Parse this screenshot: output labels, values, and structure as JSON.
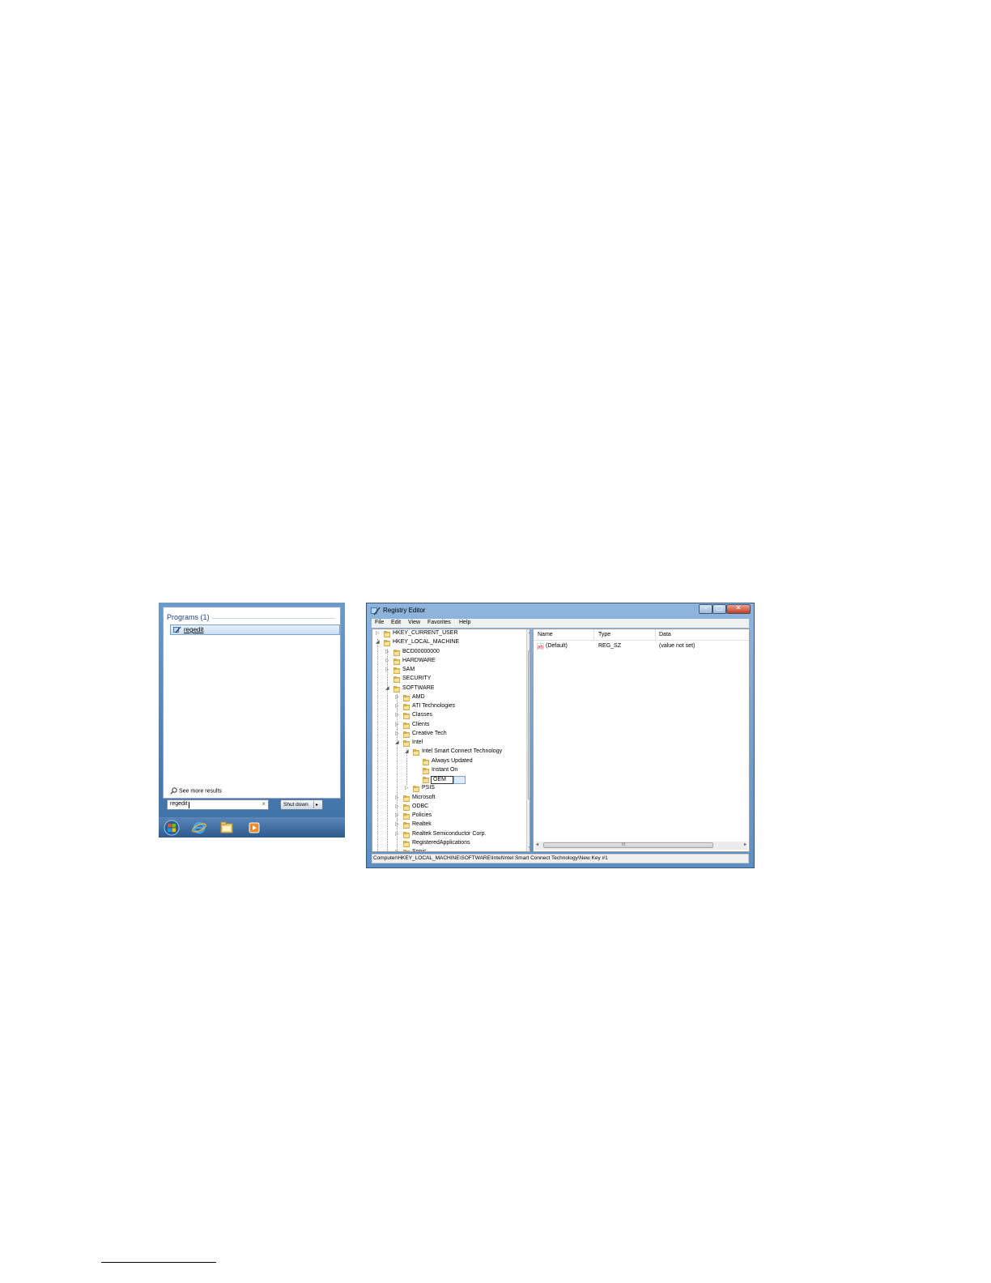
{
  "start_menu": {
    "programs_header": "Programs (1)",
    "result_label": "regedit",
    "see_more": "See more results",
    "search_value": "regedit",
    "clear_symbol": "×",
    "shutdown_label": "Shut down",
    "shutdown_arrow": "▸",
    "taskbar_icons": [
      "start-orb-icon",
      "internet-explorer-icon",
      "file-explorer-icon",
      "media-player-icon"
    ]
  },
  "registry_editor": {
    "title": "Registry Editor",
    "controls": {
      "minimize": "–",
      "maximize": "□",
      "close": "✕"
    },
    "menu": [
      "File",
      "Edit",
      "View",
      "Favorites",
      "Help"
    ],
    "tree": [
      {
        "label": "HKEY_CURRENT_USER",
        "level": 1,
        "expander": "▷"
      },
      {
        "label": "HKEY_LOCAL_MACHINE",
        "level": 1,
        "expander": "◢"
      },
      {
        "label": "BCD00000000",
        "level": 2,
        "expander": "▷"
      },
      {
        "label": "HARDWARE",
        "level": 2,
        "expander": "▷"
      },
      {
        "label": "SAM",
        "level": 2,
        "expander": "▷"
      },
      {
        "label": "SECURITY",
        "level": 2,
        "expander": ""
      },
      {
        "label": "SOFTWARE",
        "level": 2,
        "expander": "◢"
      },
      {
        "label": "AMD",
        "level": 3,
        "expander": "▷"
      },
      {
        "label": "ATI Technologies",
        "level": 3,
        "expander": "▷"
      },
      {
        "label": "Classes",
        "level": 3,
        "expander": "▷"
      },
      {
        "label": "Clients",
        "level": 3,
        "expander": "▷"
      },
      {
        "label": "Creative Tech",
        "level": 3,
        "expander": "▷"
      },
      {
        "label": "Intel",
        "level": 3,
        "expander": "◢"
      },
      {
        "label": "Intel Smart Connect Technology",
        "level": 4,
        "expander": "◢"
      },
      {
        "label": "Always Updated",
        "level": 5,
        "expander": ""
      },
      {
        "label": "Instant On",
        "level": 5,
        "expander": ""
      },
      {
        "label": "OEM",
        "level": 5,
        "expander": "",
        "editing": true
      },
      {
        "label": "PSIS",
        "level": 4,
        "expander": "▷"
      },
      {
        "label": "Microsoft",
        "level": 3,
        "expander": "▷"
      },
      {
        "label": "ODBC",
        "level": 3,
        "expander": "▷"
      },
      {
        "label": "Policies",
        "level": 3,
        "expander": "▷"
      },
      {
        "label": "Realtek",
        "level": 3,
        "expander": "▷"
      },
      {
        "label": "Realtek Semiconductor Corp.",
        "level": 3,
        "expander": "▷"
      },
      {
        "label": "RegisteredApplications",
        "level": 3,
        "expander": ""
      },
      {
        "label": "Sonic",
        "level": 3,
        "expander": "▷"
      }
    ],
    "columns": [
      "Name",
      "Type",
      "Data"
    ],
    "values": [
      {
        "name": "(Default)",
        "type": "REG_SZ",
        "data": "(value not set)"
      }
    ],
    "scroll": {
      "up": "▲",
      "down": "▼",
      "left": "◂",
      "right": "▸",
      "grip_v": "≡",
      "grip_h": "III"
    },
    "status": "Computer\\HKEY_LOCAL_MACHINE\\SOFTWARE\\Intel\\Intel Smart Connect Technology\\New Key #1"
  }
}
